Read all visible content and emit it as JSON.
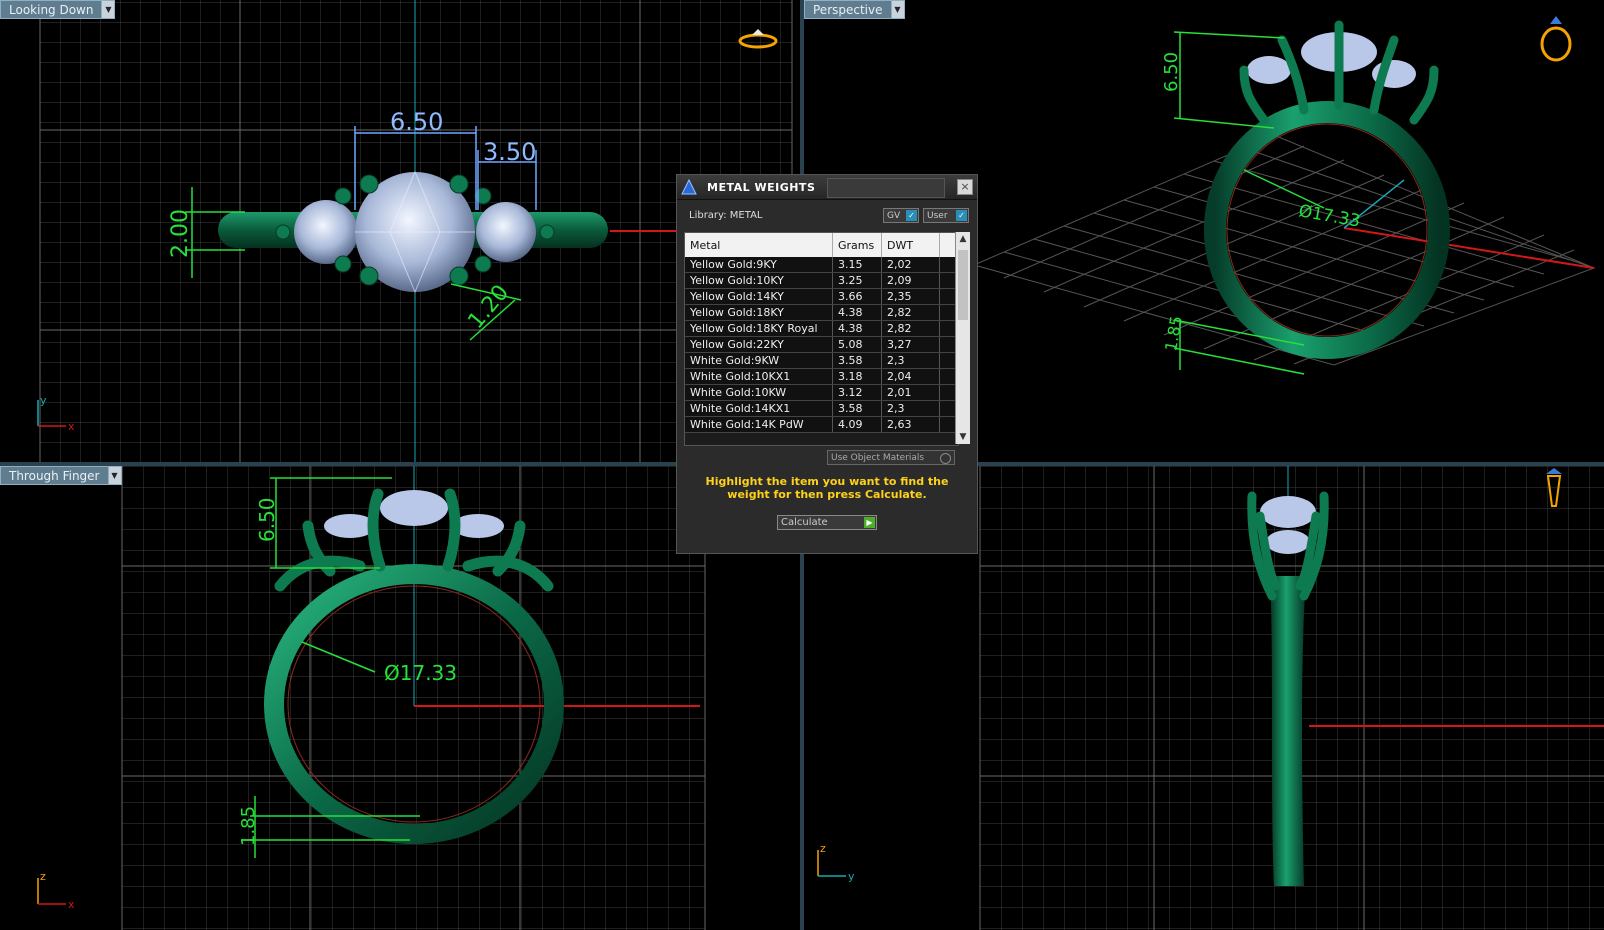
{
  "viewports": {
    "top_left": {
      "label": "Looking Down",
      "dims": {
        "width": "6.50",
        "side": "3.50",
        "height": "2.00",
        "prong": "1.20"
      },
      "axes": {
        "a": "y",
        "b": "x"
      }
    },
    "top_right": {
      "label": "Perspective",
      "dims": {
        "top": "6.50",
        "diameter": "Ø17.33",
        "bottom": "1.85"
      }
    },
    "bottom_left": {
      "label": "Through Finger",
      "dims": {
        "top": "6.50",
        "diameter": "Ø17.33",
        "bottom": "1.85"
      },
      "axes": {
        "a": "z",
        "b": "x"
      }
    },
    "bottom_right": {
      "axes": {
        "a": "z",
        "b": "y"
      }
    }
  },
  "dialog": {
    "title": "METAL WEIGHTS",
    "close": "×",
    "library_label": "Library: METAL",
    "gv_label": "GV",
    "user_label": "User",
    "columns": {
      "metal": "Metal",
      "grams": "Grams",
      "dwt": "DWT"
    },
    "rows": [
      {
        "metal": "Yellow Gold:9KY",
        "grams": "3.15",
        "dwt": "2,02"
      },
      {
        "metal": "Yellow Gold:10KY",
        "grams": "3.25",
        "dwt": "2,09"
      },
      {
        "metal": "Yellow Gold:14KY",
        "grams": "3.66",
        "dwt": "2,35"
      },
      {
        "metal": "Yellow Gold:18KY",
        "grams": "4.38",
        "dwt": "2,82"
      },
      {
        "metal": "Yellow Gold:18KY Royal",
        "grams": "4.38",
        "dwt": "2,82"
      },
      {
        "metal": "Yellow Gold:22KY",
        "grams": "5.08",
        "dwt": "3,27"
      },
      {
        "metal": "White Gold:9KW",
        "grams": "3.58",
        "dwt": "2,3"
      },
      {
        "metal": "White Gold:10KX1",
        "grams": "3.18",
        "dwt": "2,04"
      },
      {
        "metal": "White Gold:10KW",
        "grams": "3.12",
        "dwt": "2,01"
      },
      {
        "metal": "White Gold:14KX1",
        "grams": "3.58",
        "dwt": "2,3"
      },
      {
        "metal": "White Gold:14K PdW",
        "grams": "4.09",
        "dwt": "2,63"
      }
    ],
    "use_object_materials": "Use Object Materials",
    "hint": "Highlight the item you want to find the weight for then press Calculate.",
    "calculate_label": "Calculate"
  },
  "colors": {
    "ring": "#0f6b4a",
    "dimension": "#27e03a",
    "stone": "#b9c8e8",
    "grid": "#5a5a5a",
    "dialog_hint": "#ffd21a"
  }
}
